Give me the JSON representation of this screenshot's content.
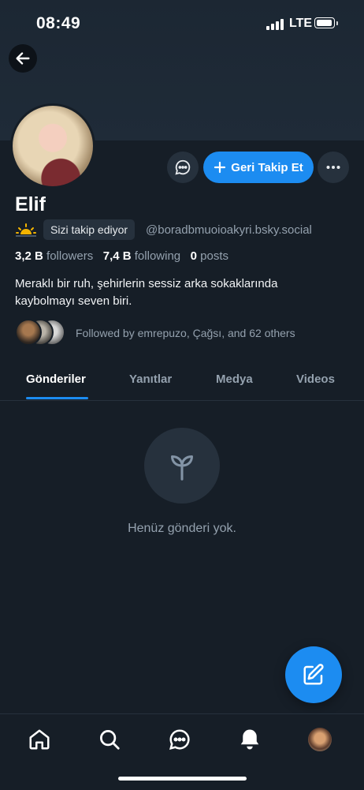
{
  "status_bar": {
    "time": "08:49",
    "network": "LTE"
  },
  "profile": {
    "name": "Elif",
    "follows_you_label": "Sizi takip ediyor",
    "handle": "@boradbmuoioakyri.bsky.social",
    "followers_count": "3,2 B",
    "followers_label": "followers",
    "following_count": "7,4 B",
    "following_label": "following",
    "posts_count": "0",
    "posts_label": "posts",
    "bio_line1": "Meraklı bir ruh, şehirlerin sessiz arka sokaklarında",
    "bio_line2": "kaybolmayı seven biri.",
    "followed_by": "Followed by emrepuzo, Çağsı, and 62 others"
  },
  "actions": {
    "follow_back_label": "Geri Takip Et"
  },
  "tabs": [
    {
      "label": "Gönderiler",
      "active": true
    },
    {
      "label": "Yanıtlar",
      "active": false
    },
    {
      "label": "Medya",
      "active": false
    },
    {
      "label": "Videos",
      "active": false
    }
  ],
  "empty_state": {
    "text": "Henüz gönderi yok."
  },
  "colors": {
    "accent": "#1c8cf1",
    "background": "#161e27",
    "muted_text": "#94a1ae"
  },
  "icons": {
    "back": "arrow-left-icon",
    "message": "chat-bubble-icon",
    "plus": "plus-icon",
    "more": "ellipsis-icon",
    "sun": "sunrise-icon",
    "empty": "sprout-icon",
    "compose": "compose-icon",
    "nav": [
      "home-icon",
      "search-icon",
      "chat-icon",
      "bell-icon",
      "profile-avatar"
    ]
  }
}
